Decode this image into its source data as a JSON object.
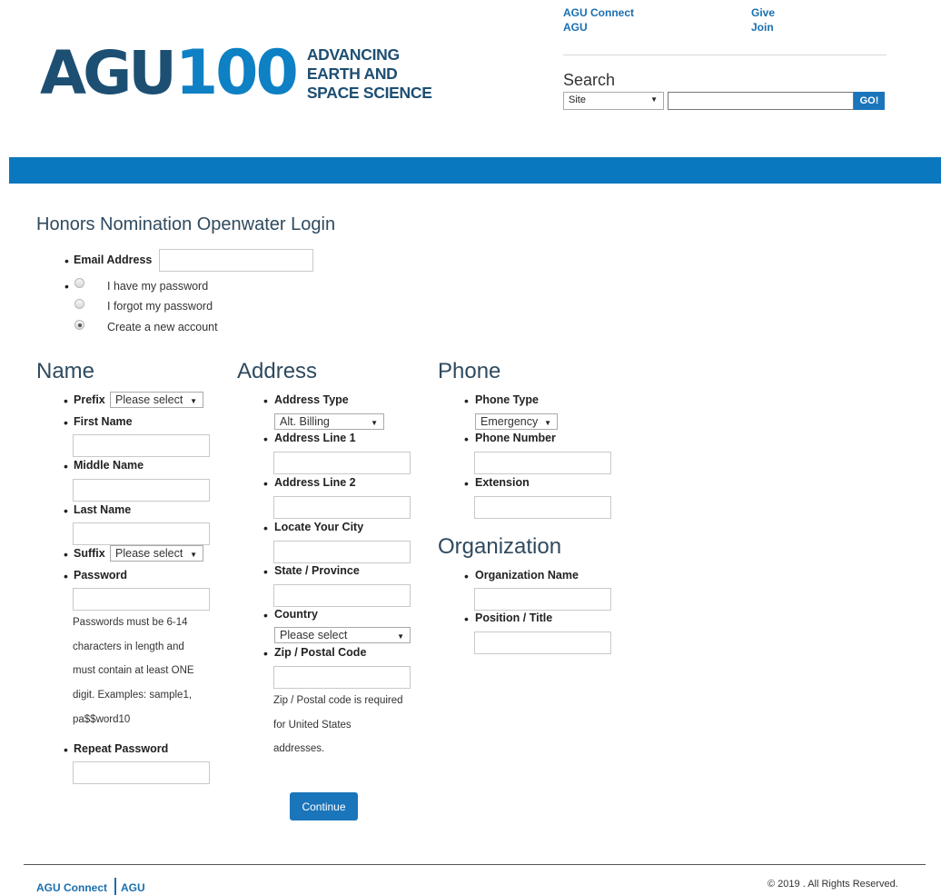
{
  "header": {
    "logo": {
      "agu": "AGU",
      "number": "100",
      "tagline": [
        "ADVANCING",
        "EARTH AND",
        "SPACE SCIENCE"
      ]
    },
    "links": {
      "agu_connect": "AGU Connect",
      "agu": "AGU",
      "give": "Give",
      "join": "Join"
    },
    "search": {
      "label": "Search",
      "scope": "Site",
      "go": "GO!"
    }
  },
  "colors": {
    "brand_blue": "#0a78bf",
    "logo_dark": "#1d4f73",
    "heading": "#2f4a5f"
  },
  "form": {
    "title": "Honors Nomination Openwater Login",
    "email_label": "Email Address",
    "options": [
      {
        "label": "I have my password",
        "checked": false
      },
      {
        "label": "I forgot my password",
        "checked": false
      },
      {
        "label": "Create a new account",
        "checked": true
      }
    ],
    "name": {
      "heading": "Name",
      "prefix_label": "Prefix",
      "prefix_value": "Please select",
      "first_name": "First Name",
      "middle_name": "Middle Name",
      "last_name": "Last Name",
      "suffix_label": "Suffix",
      "suffix_value": "Please select",
      "password": "Password",
      "password_help": [
        "Passwords must be 6-14",
        "characters in length and",
        "must contain at least ONE",
        "digit. Examples: sample1,",
        "pa$$word10"
      ],
      "repeat_password": "Repeat Password"
    },
    "address": {
      "heading": "Address",
      "type_label": "Address Type",
      "type_value": "Alt. Billing",
      "line1": "Address Line 1",
      "line2": "Address Line 2",
      "city": "Locate Your City",
      "state": "State / Province",
      "country_label": "Country",
      "country_value": "Please select",
      "zip": "Zip / Postal Code",
      "zip_help": [
        "Zip / Postal code is required",
        "for United States",
        "addresses."
      ]
    },
    "phone": {
      "heading": "Phone",
      "type_label": "Phone Type",
      "type_value": "Emergency",
      "number": "Phone Number",
      "extension": "Extension"
    },
    "organization": {
      "heading": "Organization",
      "name": "Organization Name",
      "position": "Position / Title"
    },
    "continue": "Continue"
  },
  "footer": {
    "agu_connect": "AGU Connect",
    "agu": "AGU",
    "copyright": "© 2019 . All Rights Reserved."
  }
}
